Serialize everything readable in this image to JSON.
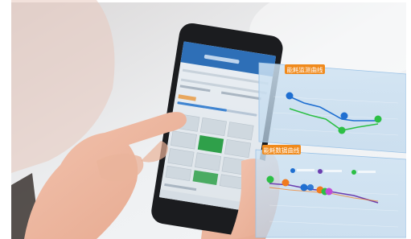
{
  "overlay": {
    "panel1_title": "能耗监测曲线",
    "panel2_title": "能耗数据曲线"
  },
  "phone": {
    "screen_header_color": "#2e6fb7",
    "selected_tile_color": "#2fa04a"
  },
  "colors": {
    "overlay_accent": "#f08a1c",
    "line_blue": "#1f6fd1",
    "line_green": "#2cbf45",
    "line_purple": "#6b3fb0",
    "marker_orange": "#f07a1e",
    "marker_magenta": "#c24bd6"
  }
}
